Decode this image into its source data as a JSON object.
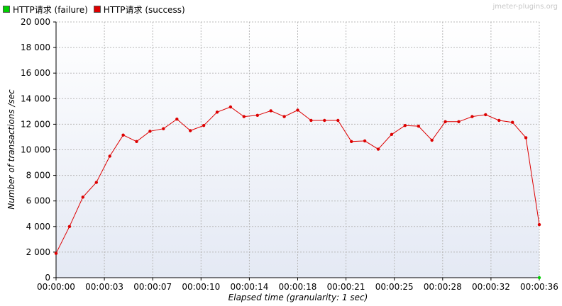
{
  "legend": [
    {
      "label": "HTTP请求 (failure)",
      "color": "#00d000"
    },
    {
      "label": "HTTP请求 (success)",
      "color": "#dd0000"
    }
  ],
  "watermark": "jmeter-plugins.org",
  "chart_data": {
    "type": "line",
    "xlabel": "Elapsed time (granularity: 1 sec)",
    "ylabel": "Number of transactions /sec",
    "xlim": [
      0,
      36
    ],
    "ylim": [
      0,
      20000
    ],
    "grid": true,
    "legend_position": "top-left",
    "x_ticks": [
      "00:00:00",
      "00:00:03",
      "00:00:07",
      "00:00:10",
      "00:00:14",
      "00:00:18",
      "00:00:21",
      "00:00:25",
      "00:00:28",
      "00:00:32",
      "00:00:36"
    ],
    "x_tick_seconds": [
      0,
      3.6,
      7.2,
      10.8,
      14.4,
      18,
      21.6,
      25.2,
      28.8,
      32.4,
      36
    ],
    "y_ticks": [
      "0",
      "2 000",
      "4 000",
      "6 000",
      "8 000",
      "10 000",
      "12 000",
      "14 000",
      "16 000",
      "18 000",
      "20 000"
    ],
    "y_tick_values": [
      0,
      2000,
      4000,
      6000,
      8000,
      10000,
      12000,
      14000,
      16000,
      18000,
      20000
    ],
    "series": [
      {
        "name": "HTTP请求 (failure)",
        "color": "#00d000",
        "x": [
          36
        ],
        "values": [
          0
        ]
      },
      {
        "name": "HTTP请求 (success)",
        "color": "#dd0000",
        "x": [
          0,
          1,
          2,
          3,
          4,
          5,
          6,
          7,
          8,
          9,
          10,
          11,
          12,
          13,
          14,
          15,
          16,
          17,
          18,
          19,
          20,
          21,
          22,
          23,
          24,
          25,
          26,
          27,
          28,
          29,
          30,
          31,
          32,
          33,
          34,
          35,
          36
        ],
        "values": [
          1900,
          4000,
          6300,
          7450,
          9500,
          11150,
          10650,
          11450,
          11650,
          12400,
          11500,
          11900,
          12950,
          13350,
          12600,
          12700,
          13050,
          12600,
          13100,
          12300,
          12300,
          12300,
          10650,
          10700,
          10050,
          11200,
          11900,
          11850,
          10750,
          12200,
          12200,
          12600,
          12750,
          12300,
          12150,
          10950,
          4150
        ]
      }
    ]
  }
}
